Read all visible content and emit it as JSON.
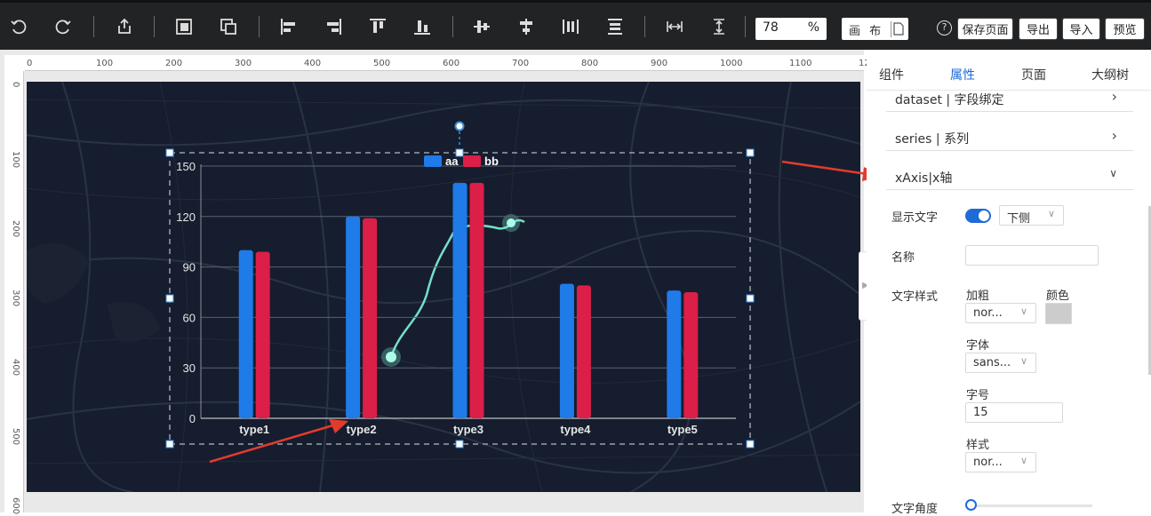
{
  "toolbar": {
    "zoom_value": "78",
    "zoom_unit": "%",
    "canvas_label": "画 布",
    "save_label": "保存页面",
    "export_label": "导出",
    "import_label": "导入",
    "preview_label": "预览",
    "help_label": "?"
  },
  "rulers": {
    "top": [
      "0",
      "100",
      "200",
      "300",
      "400",
      "500",
      "600",
      "700",
      "800",
      "900",
      "1000",
      "1100",
      "120"
    ],
    "left": [
      "0",
      "100",
      "200",
      "300",
      "400",
      "500",
      "600"
    ]
  },
  "panel": {
    "tabs": [
      "组件",
      "属性",
      "页面",
      "大纲树"
    ],
    "sections": {
      "dataset": "dataset | 字段绑定",
      "series": "series | 系列",
      "xaxis": "xAxis|x轴"
    },
    "show_text_label": "显示文字",
    "position_value": "下侧",
    "name_label": "名称",
    "text_style_label": "文字样式",
    "bold_label": "加粗",
    "bold_value": "nor...",
    "color_label": "颜色",
    "color_value": "#cccccc",
    "font_label": "字体",
    "font_value": "sans...",
    "size_label": "字号",
    "size_value": "15",
    "style_label": "样式",
    "style_value": "nor...",
    "angle_label": "文字角度"
  },
  "chart_data": {
    "type": "bar",
    "categories": [
      "type1",
      "type2",
      "type3",
      "type4",
      "type5"
    ],
    "series": [
      {
        "name": "aa",
        "values": [
          100,
          120,
          140,
          80,
          76
        ],
        "color": "#1f7be8"
      },
      {
        "name": "bb",
        "values": [
          99,
          119,
          140,
          79,
          75
        ],
        "color": "#dc1f48"
      }
    ],
    "ylim": [
      0,
      150
    ],
    "yticks": [
      "0",
      "30",
      "60",
      "90",
      "120",
      "150"
    ],
    "grid": true,
    "legend": "top-center"
  },
  "colors": {
    "accent": "#1f6bd6",
    "annotation_arrow": "#e23b2e",
    "map_background": "#161d2e"
  }
}
